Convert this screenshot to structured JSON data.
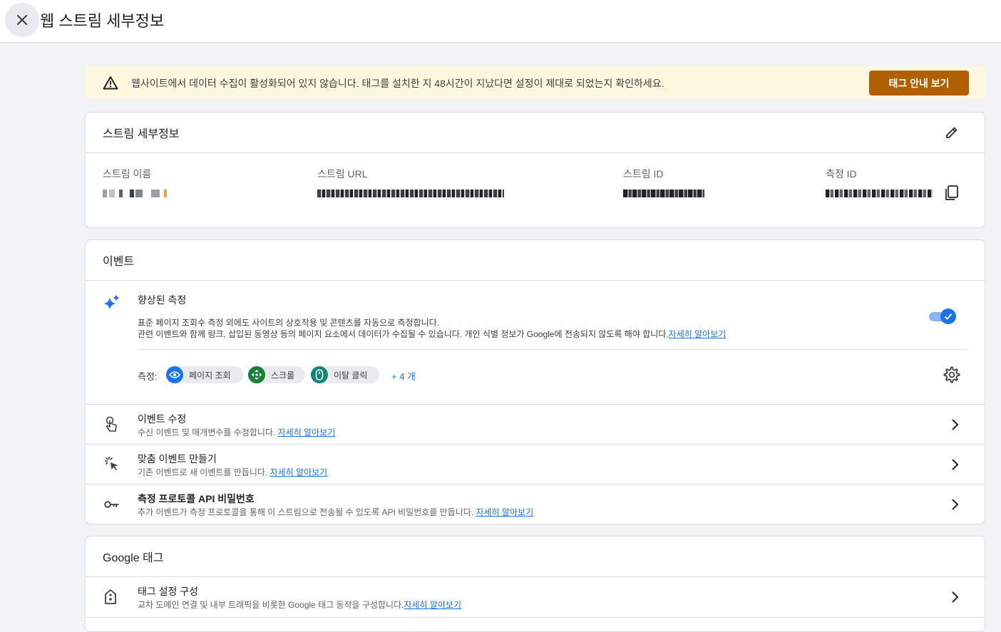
{
  "header": {
    "title": "웹 스트림 세부정보"
  },
  "banner": {
    "message": "웹사이트에서 데이터 수집이 활성화되어 있지 않습니다. 태그를 설치한 지 48시간이 지났다면 설정이 제대로 되었는지 확인하세요.",
    "button_label": "태그 안내 보기",
    "accent_color": "#b06000"
  },
  "stream_details": {
    "title": "스트림 세부정보",
    "name_label": "스트림 이름",
    "url_label": "스트림 URL",
    "id_label": "스트림 ID",
    "measurement_label": "측정 ID"
  },
  "events": {
    "title": "이벤트",
    "enhanced": {
      "title": "향상된 측정",
      "desc_line1": "표준 페이지 조회수 측정 외에도 사이트의 상호작용 및 콘텐츠를 자동으로 측정합니다.",
      "desc_line2": "관련 이벤트와 함께 링크, 삽입된 동영상 등의 페이지 요소에서 데이터가 수집될 수 있습니다. 개인 식별 정보가 Google에 전송되지 않도록 해야 합니다.",
      "learn_more": "자세히 알아보기",
      "enabled": true,
      "measure_label": "측정:",
      "chips": [
        {
          "label": "페이지 조회",
          "icon": "eye-icon",
          "color": "#1a73e8"
        },
        {
          "label": "스크롤",
          "icon": "scroll-icon",
          "color": "#188038"
        },
        {
          "label": "이탈 클릭",
          "icon": "mouse-icon",
          "color": "#12857a"
        }
      ],
      "more": "+ 4 개"
    },
    "rows": [
      {
        "title": "이벤트 수정",
        "sub": "수신 이벤트 및 매개변수를 수정합니다. ",
        "link": "자세히 알아보기"
      },
      {
        "title": "맞춤 이벤트 만들기",
        "sub": "기존 이벤트로 새 이벤트를 만듭니다. ",
        "link": "자세히 알아보기"
      },
      {
        "title": "측정 프로토콜 API 비밀번호",
        "sub": "추가 이벤트가 측정 프로토콜을 통해 이 스트림으로 전송될 수 있도록 API 비밀번호를 만듭니다. ",
        "link": "자세히 알아보기"
      }
    ]
  },
  "google_tag": {
    "title": "Google 태그",
    "rows": [
      {
        "title": "태그 설정 구성",
        "sub": "교차 도메인 연결 및 내부 트래픽을 비롯한 Google 태그 동작을 구성합니다.",
        "link": "자세히 알아보기"
      }
    ]
  }
}
